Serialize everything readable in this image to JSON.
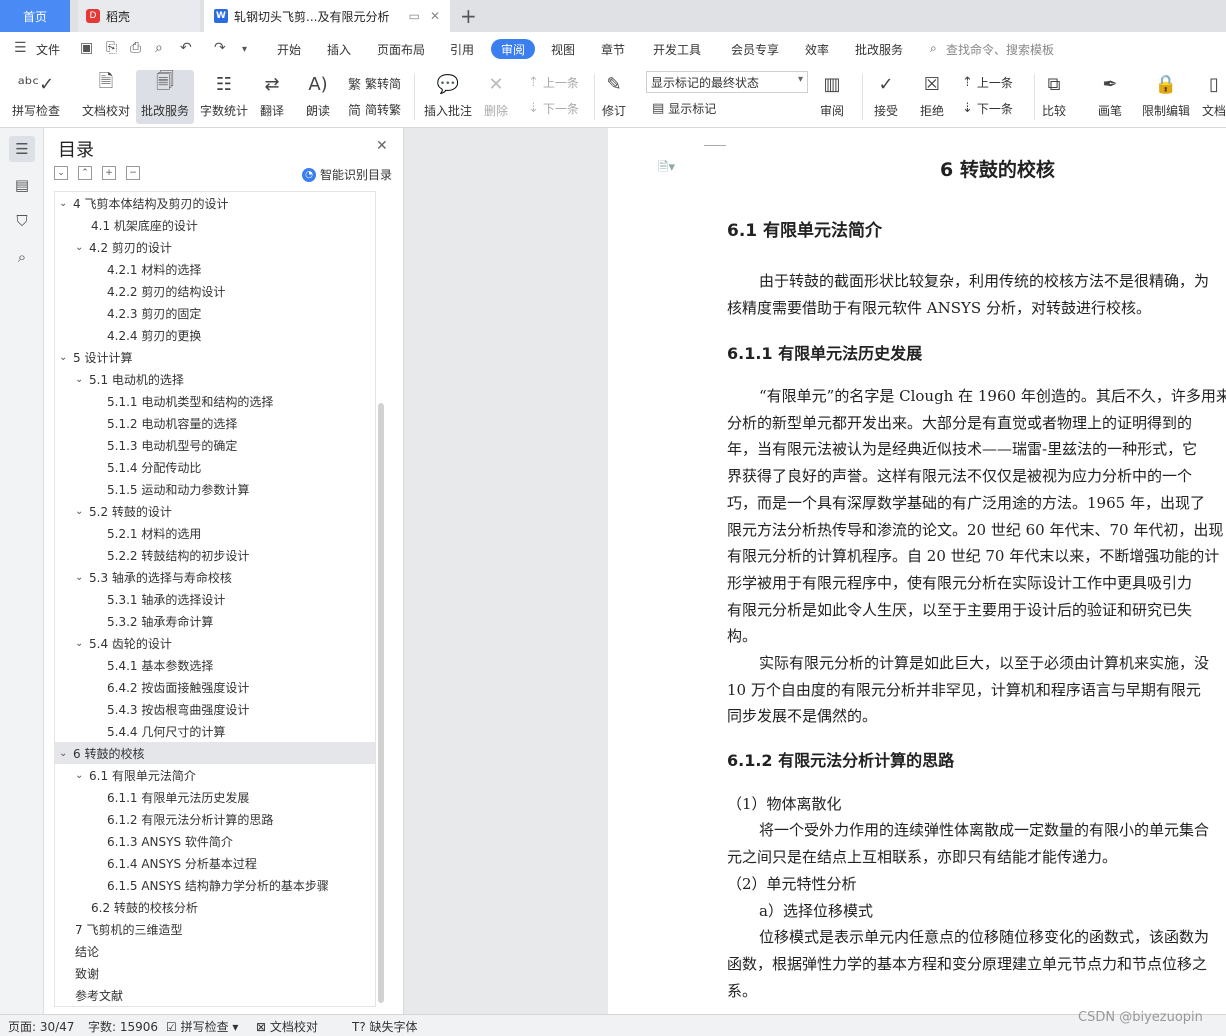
{
  "tabs": {
    "home": "首页",
    "daoke": "稻壳",
    "doc_title": "轧钢切头飞剪...及有限元分析"
  },
  "menu": {
    "file": "文件",
    "items": [
      "开始",
      "插入",
      "页面布局",
      "引用",
      "审阅",
      "视图",
      "章节",
      "开发工具",
      "会员专享",
      "效率",
      "批改服务"
    ],
    "active": "审阅",
    "search_placeholder": "查找命令、搜索模板"
  },
  "ribbon": {
    "spell": "拼写检查",
    "proofread": "文档校对",
    "correction": "批改服务",
    "wordcount": "字数统计",
    "translate": "翻译",
    "read": "朗读",
    "trad": "繁转简",
    "simp": "简转繁",
    "insert_comment": "插入批注",
    "delete": "删除",
    "prev": "上一条",
    "next": "下一条",
    "revise": "修订",
    "markup_state": "显示标记的最终状态",
    "show_markup": "显示标记",
    "review": "审阅",
    "accept": "接受",
    "reject": "拒绝",
    "prev2": "上一条",
    "next2": "下一条",
    "compare": "比较",
    "pen": "画笔",
    "restrict": "限制编辑",
    "doc_more": "文档"
  },
  "toc": {
    "title": "目录",
    "smart": "智能识别目录",
    "items": [
      {
        "label": "4  飞剪本体结构及剪刃的设计",
        "level": 1,
        "caret": "⌄"
      },
      {
        "label": "4.1 机架底座的设计",
        "level": 2,
        "caret": ""
      },
      {
        "label": "4.2 剪刃的设计",
        "level": 2,
        "caret": "⌄"
      },
      {
        "label": "4.2.1 材料的选择",
        "level": 3,
        "caret": ""
      },
      {
        "label": "4.2.2 剪刃的结构设计",
        "level": 3,
        "caret": ""
      },
      {
        "label": "4.2.3 剪刃的固定",
        "level": 3,
        "caret": ""
      },
      {
        "label": "4.2.4  剪刃的更换",
        "level": 3,
        "caret": ""
      },
      {
        "label": "5  设计计算",
        "level": 1,
        "caret": "⌄"
      },
      {
        "label": "5.1 电动机的选择",
        "level": 2,
        "caret": "⌄"
      },
      {
        "label": "5.1.1  电动机类型和结构的选择",
        "level": 3,
        "caret": ""
      },
      {
        "label": "5.1.2  电动机容量的选择",
        "level": 3,
        "caret": ""
      },
      {
        "label": "5.1.3  电动机型号的确定",
        "level": 3,
        "caret": ""
      },
      {
        "label": "5.1.4  分配传动比",
        "level": 3,
        "caret": ""
      },
      {
        "label": "5.1.5  运动和动力参数计算",
        "level": 3,
        "caret": ""
      },
      {
        "label": "5.2  转鼓的设计",
        "level": 2,
        "caret": "⌄"
      },
      {
        "label": "5.2.1  材料的选用",
        "level": 3,
        "caret": ""
      },
      {
        "label": "5.2.2  转鼓结构的初步设计",
        "level": 3,
        "caret": ""
      },
      {
        "label": "5.3 轴承的选择与寿命校核",
        "level": 2,
        "caret": "⌄"
      },
      {
        "label": "5.3.1  轴承的选择设计",
        "level": 3,
        "caret": ""
      },
      {
        "label": "5.3.2  轴承寿命计算",
        "level": 3,
        "caret": ""
      },
      {
        "label": "5.4  齿轮的设计",
        "level": 2,
        "caret": "⌄"
      },
      {
        "label": "5.4.1  基本参数选择",
        "level": 3,
        "caret": ""
      },
      {
        "label": "6.4.2  按齿面接触强度设计",
        "level": 3,
        "caret": ""
      },
      {
        "label": "5.4.3 按齿根弯曲强度设计",
        "level": 3,
        "caret": ""
      },
      {
        "label": "5.4.4  几何尺寸的计算",
        "level": 3,
        "caret": ""
      },
      {
        "label": "6  转鼓的校核",
        "level": 1,
        "caret": "⌄",
        "selected": true
      },
      {
        "label": "6.1 有限单元法简介",
        "level": 2,
        "caret": "⌄"
      },
      {
        "label": "6.1.1  有限单元法历史发展",
        "level": 3,
        "caret": ""
      },
      {
        "label": "6.1.2 有限元法分析计算的思路",
        "level": 3,
        "caret": ""
      },
      {
        "label": "6.1.3   ANSYS 软件简介",
        "level": 3,
        "caret": ""
      },
      {
        "label": "6.1.4   ANSYS 分析基本过程",
        "level": 3,
        "caret": ""
      },
      {
        "label": "6.1.5 ANSYS 结构静力学分析的基本步骤",
        "level": 3,
        "caret": ""
      },
      {
        "label": "6.2  转鼓的校核分析",
        "level": 2,
        "caret": ""
      },
      {
        "label": "7 飞剪机的三维造型",
        "level": 0,
        "caret": ""
      },
      {
        "label": "结论",
        "level": 0,
        "caret": ""
      },
      {
        "label": "致谢",
        "level": 0,
        "caret": ""
      },
      {
        "label": "参考文献",
        "level": 0,
        "caret": ""
      }
    ]
  },
  "doc": {
    "chapter": "6  转鼓的校核",
    "s61": "6.1 有限单元法简介",
    "p1": [
      "由于转鼓的截面形状比较复杂，利用传统的校核方法不是很精确，为",
      "核精度需要借助于有限元软件 ANSYS 分析，对转鼓进行校核。"
    ],
    "s611": "6.1.1  有限单元法历史发展",
    "p2": [
      "“有限单元”的名字是 Clough 在 1960 年创造的。其后不久，许多用来",
      "分析的新型单元都开发出来。大部分是有直觉或者物理上的证明得到的",
      "年，当有限元法被认为是经典近似技术——瑞雷-里兹法的一种形式，它",
      "界获得了良好的声誉。这样有限元法不仅仅是被视为应力分析中的一个",
      "巧，而是一个具有深厚数学基础的有广泛用途的方法。1965 年，出现了",
      "限元方法分析热传导和渗流的论文。20 世纪 60 年代末、70 年代初，出现",
      "有限元分析的计算机程序。自 20 世纪 70 年代末以来，不断增强功能的计",
      "形学被用于有限元程序中，使有限元分析在实际设计工作中更具吸引力",
      "有限元分析是如此令人生厌，以至于主要用于设计后的验证和研究已失",
      "构。"
    ],
    "p3": [
      "实际有限元分析的计算是如此巨大，以至于必须由计算机来实施，没",
      "10 万个自由度的有限元分析并非罕见，计算机和程序语言与早期有限元",
      "同步发展不是偶然的。"
    ],
    "s612": "6.1.2 有限元法分析计算的思路",
    "l1": "（1）物体离散化",
    "p4": [
      "将一个受外力作用的连续弹性体离散成一定数量的有限小的单元集合",
      "元之间只是在结点上互相联系，亦即只有结能才能传递力。"
    ],
    "l2": "（2）单元特性分析",
    "l3": "a）选择位移模式",
    "p5": [
      "位移模式是表示单元内任意点的位移随位移变化的函数式，该函数为",
      "函数，根据弹性力学的基本方程和变分原理建立单元节点力和节点位移之",
      "系。"
    ]
  },
  "status": {
    "page": "页面: 30/47",
    "words": "字数: 15906",
    "spell": "拼写检查",
    "proof": "文档校对",
    "font": "缺失字体",
    "watermark": "CSDN @biyezuopin"
  }
}
